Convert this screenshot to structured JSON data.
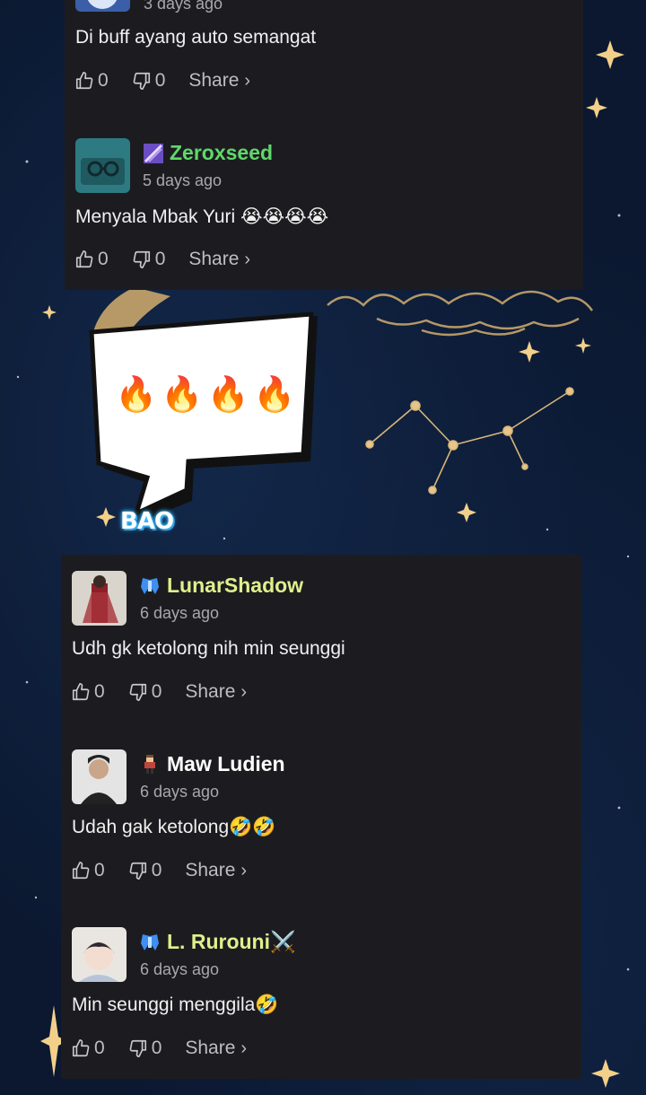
{
  "colors": {
    "card_bg": "#1c1c20",
    "username_green": "#5fd86a",
    "username_lime": "#dff08c",
    "username_white": "#ffffff",
    "muted": "#a8a8ad"
  },
  "top_card": {
    "partial_time": "3 days ago",
    "partial_text": "Di buff ayang auto semangat",
    "partial_likes": "0",
    "partial_dislikes": "0",
    "comments": [
      {
        "username": "Zeroxseed",
        "badge_icon": "purple-rank-badge-icon",
        "time": "5 days ago",
        "text": "Menyala Mbak Yuri 😭😭😭😭",
        "likes": "0",
        "dislikes": "0"
      }
    ]
  },
  "sticker": {
    "flames": "🔥🔥🔥🔥",
    "brand": "BAO"
  },
  "bottom_card": {
    "comments": [
      {
        "username": "LunarShadow",
        "badge_icon": "blue-wings-badge-icon",
        "time": "6 days ago",
        "text": "Udh gk ketolong nih min seunggi",
        "likes": "0",
        "dislikes": "0"
      },
      {
        "username": "Maw Ludien",
        "badge_icon": "pixel-character-badge-icon",
        "time": "6 days ago",
        "text": "Udah gak ketolong🤣🤣",
        "likes": "0",
        "dislikes": "0"
      },
      {
        "username": "L. Rurouni⚔️",
        "badge_icon": "blue-wings-badge-icon",
        "time": "6 days ago",
        "text": "Min seunggi menggila🤣",
        "likes": "0",
        "dislikes": "0"
      }
    ]
  },
  "share_label": "Share"
}
